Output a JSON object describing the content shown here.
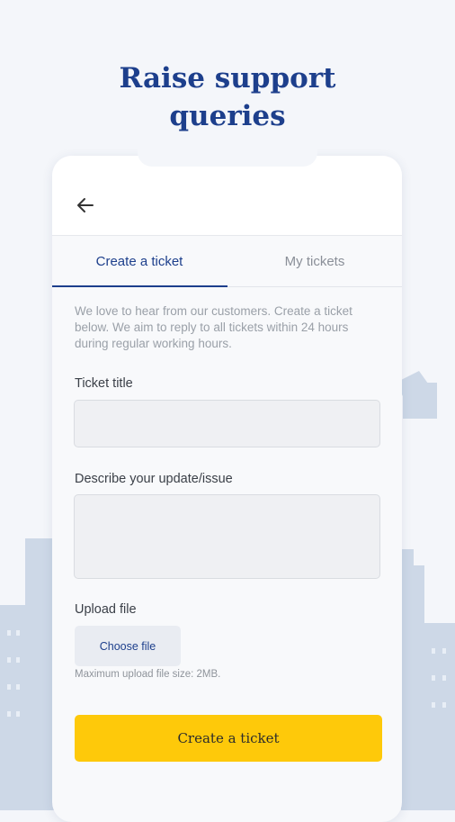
{
  "headline": {
    "line1": "Raise support",
    "line2": "queries"
  },
  "tabs": [
    {
      "label": "Create a ticket",
      "active": true
    },
    {
      "label": "My tickets",
      "active": false
    }
  ],
  "intro": "We love to hear from our customers. Create a ticket below. We aim to reply to all tickets within 24 hours during regular working hours.",
  "form": {
    "ticket_title_label": "Ticket title",
    "ticket_title_value": "",
    "describe_label": "Describe your update/issue",
    "describe_value": "",
    "upload_label": "Upload file",
    "choose_file_label": "Choose file",
    "upload_hint": "Maximum upload file size: 2MB.",
    "submit_label": "Create a ticket"
  },
  "icons": {
    "back": "arrow-left-icon"
  },
  "colors": {
    "brand_blue": "#1d3f8c",
    "accent_yellow": "#fec90a",
    "skyline": "#cdd8e7",
    "background": "#f4f6fa"
  }
}
